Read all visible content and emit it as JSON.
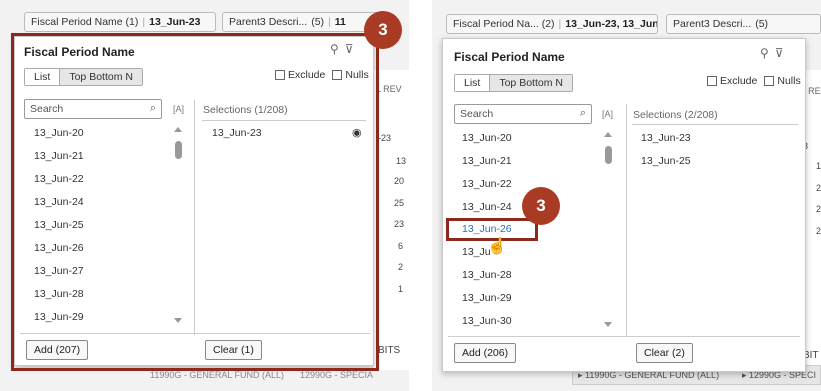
{
  "left": {
    "chip_period": {
      "label": "Fiscal Period Name (1)",
      "value": "13_Jun-23"
    },
    "chip_parent3": {
      "label": "Parent3 Descri...",
      "count": "(5)",
      "value": "11"
    },
    "popup": {
      "title": "Fiscal Period Name",
      "tabs": [
        "List",
        "Top Bottom N"
      ],
      "exclude_label": "Exclude",
      "nulls_label": "Nulls",
      "search_placeholder": "Search",
      "sort_label": "[A]",
      "items": [
        "13_Jun-20",
        "13_Jun-21",
        "13_Jun-22",
        "13_Jun-24",
        "13_Jun-25",
        "13_Jun-26",
        "13_Jun-27",
        "13_Jun-28",
        "13_Jun-29"
      ],
      "selections_title": "Selections (1/208)",
      "selections": [
        "13_Jun-23"
      ],
      "add_button": "Add (207)",
      "clear_button": "Clear (1)"
    },
    "badge": "3",
    "background": {
      "col_header": "L REV",
      "row_label": "-23",
      "values": [
        "13",
        "20",
        "25",
        "23",
        "6",
        "2",
        "1"
      ],
      "footer_label": "BITS",
      "footer_items": [
        "11990G - GENERAL FUND (ALL)",
        "12990G - SPECIA"
      ]
    }
  },
  "right": {
    "chip_period": {
      "label": "Fiscal Period Na... (2)",
      "value": "13_Jun-23, 13_Jun-..."
    },
    "chip_parent3": {
      "label": "Parent3 Descri...",
      "count": "(5)"
    },
    "popup": {
      "title": "Fiscal Period Name",
      "tabs": [
        "List",
        "Top Bottom N"
      ],
      "exclude_label": "Exclude",
      "nulls_label": "Nulls",
      "search_placeholder": "Search",
      "sort_label": "[A]",
      "items": [
        "13_Jun-20",
        "13_Jun-21",
        "13_Jun-22",
        "13_Jun-24",
        "13_Jun-26",
        "13_Ju",
        "13_Jun-28",
        "13_Jun-29",
        "13_Jun-30"
      ],
      "selections_title": "Selections (2/208)",
      "selections": [
        "13_Jun-23",
        "13_Jun-25"
      ],
      "add_button": "Add (206)",
      "clear_button": "Clear (2)"
    },
    "badge": "3",
    "background": {
      "col_header": "L RE",
      "row_label": "n-23",
      "values": [
        "1",
        "2",
        "2",
        "2"
      ],
      "footer_label": "BIT",
      "footer_items": [
        "▸ 11990G - GENERAL FUND (ALL)",
        "▸ 12990G - SPECI"
      ]
    }
  },
  "colors": {
    "highlight": "#8b2a1b",
    "badge": "#a93a24",
    "link": "#2e6fb7"
  },
  "icons": [
    "filter-settings-icon",
    "clear-filter-icon",
    "search-icon",
    "eye-icon",
    "hand-pointer-icon"
  ]
}
